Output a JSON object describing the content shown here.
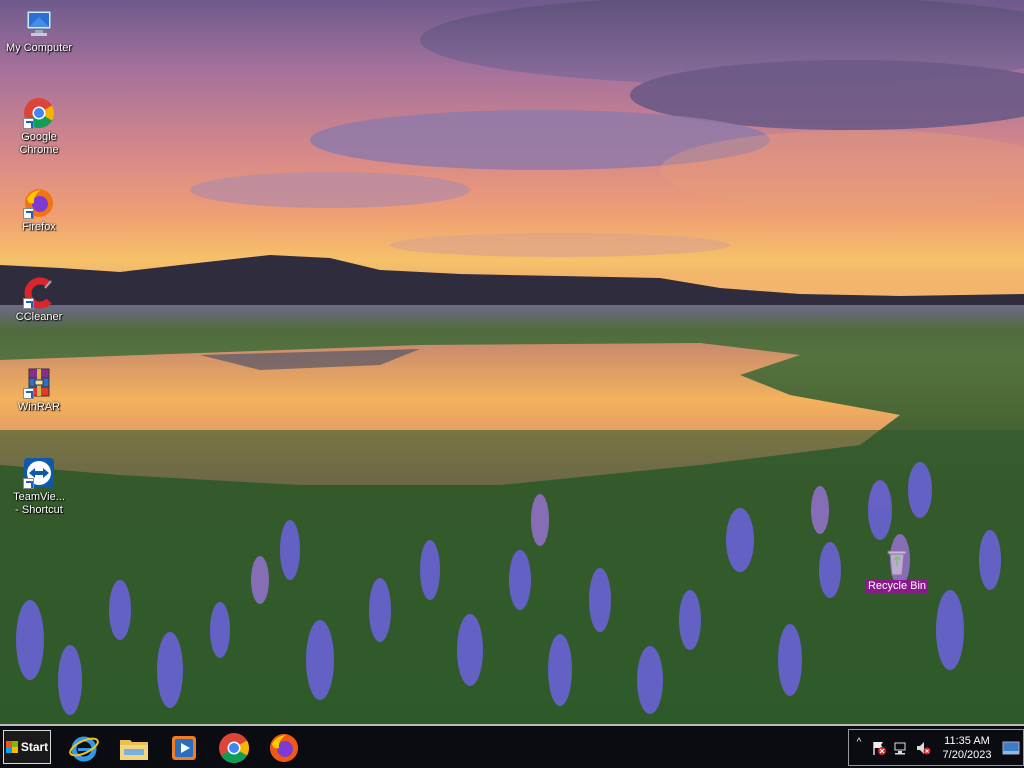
{
  "desktop": {
    "icons": [
      {
        "label": "My Computer"
      },
      {
        "label": "Google Chrome"
      },
      {
        "label": "Firefox"
      },
      {
        "label": "CCleaner"
      },
      {
        "label": "WinRAR"
      },
      {
        "label": "TeamVie...\n- Shortcut"
      },
      {
        "label": "Recycle Bin"
      }
    ]
  },
  "taskbar": {
    "start_label": "Start",
    "pinned": [
      {
        "icon": "internet-explorer-icon"
      },
      {
        "icon": "file-explorer-icon"
      },
      {
        "icon": "media-player-icon"
      },
      {
        "icon": "chrome-icon"
      },
      {
        "icon": "firefox-icon"
      }
    ],
    "tray": {
      "time": "11:35 AM",
      "date": "7/20/2023"
    }
  },
  "colors": {
    "taskbar_bg": "#0b0b12",
    "recycle_label_bg": "#8a1a8c"
  }
}
